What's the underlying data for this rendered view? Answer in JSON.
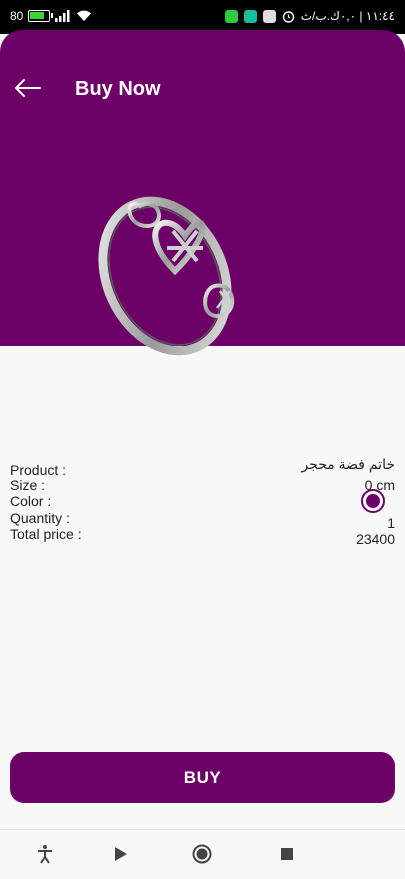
{
  "status_bar": {
    "left_text": "80",
    "battery_level": 0.75,
    "right_text": "١١:٤٤ | ٠,٠ك.ب/ث"
  },
  "header": {
    "title": "Buy Now",
    "back_icon": "arrow-left-icon",
    "background_color": "#6c0066"
  },
  "product": {
    "image_icon": "celtic-heart-ring"
  },
  "details": {
    "labels": {
      "product": "Product :",
      "size": "Size :",
      "color": "Color :",
      "quantity": "Quantity :",
      "total_price": "Total price :"
    },
    "values": {
      "product": "خاتم فضة محجر",
      "size": "0 cm",
      "color": "#6c0066",
      "quantity": "1",
      "total_price": "23400"
    }
  },
  "actions": {
    "buy_label": "BUY"
  },
  "nav_bar": {
    "icons": [
      "accessibility-icon",
      "play-icon",
      "home-icon",
      "stop-icon"
    ]
  }
}
